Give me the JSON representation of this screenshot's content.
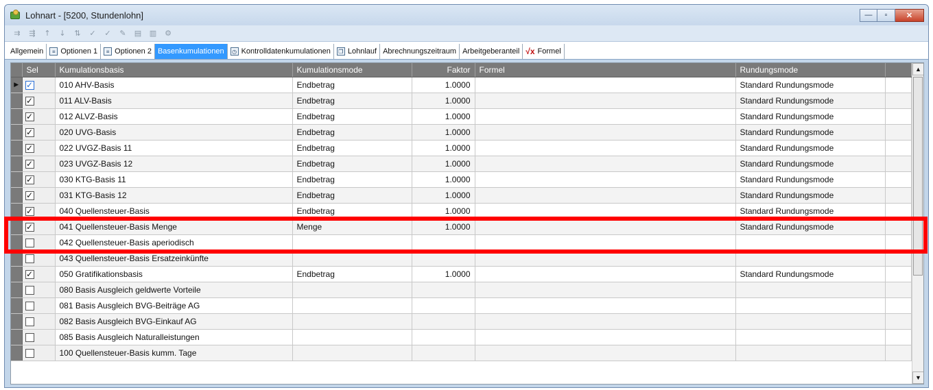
{
  "window": {
    "title": "Lohnart - [5200, Stundenlohn]",
    "buttons": {
      "minimize": "—",
      "maximize": "▫",
      "close": "✕"
    }
  },
  "toolbar": {
    "icons": [
      "insert-row-icon",
      "delete-row-icon",
      "move-up-icon",
      "move-down-icon",
      "sort-icon",
      "spell-check-icon",
      "spell-check-all-icon",
      "edit-icon",
      "report-icon",
      "report-list-icon",
      "properties-icon"
    ]
  },
  "tabs": [
    {
      "label": "Allgemein",
      "icon": ""
    },
    {
      "label": "Optionen 1",
      "icon": "page-icon"
    },
    {
      "label": "Optionen 2",
      "icon": "page-icon"
    },
    {
      "label": "Basenkumulationen",
      "icon": "",
      "active": true
    },
    {
      "label": "Kontrolldatenkumulationen",
      "icon": "clock-icon"
    },
    {
      "label": "Lohnlauf",
      "icon": "copy-icon"
    },
    {
      "label": "Abrechnungszeitraum",
      "icon": ""
    },
    {
      "label": "Arbeitgeberanteil",
      "icon": ""
    },
    {
      "label": "Formel",
      "icon": "formula-icon"
    }
  ],
  "grid": {
    "columns": {
      "sel": "Sel",
      "basis": "Kumulationsbasis",
      "mode": "Kumulationsmode",
      "faktor": "Faktor",
      "formel": "Formel",
      "rundung": "Rundungsmode"
    },
    "rows": [
      {
        "checked": true,
        "basis": "010 AHV-Basis",
        "mode": "Endbetrag",
        "faktor": "1.0000",
        "formel": "",
        "rundung": "Standard Rundungsmode",
        "current": true
      },
      {
        "checked": true,
        "basis": "011 ALV-Basis",
        "mode": "Endbetrag",
        "faktor": "1.0000",
        "formel": "",
        "rundung": "Standard Rundungsmode"
      },
      {
        "checked": true,
        "basis": "012 ALVZ-Basis",
        "mode": "Endbetrag",
        "faktor": "1.0000",
        "formel": "",
        "rundung": "Standard Rundungsmode"
      },
      {
        "checked": true,
        "basis": "020 UVG-Basis",
        "mode": "Endbetrag",
        "faktor": "1.0000",
        "formel": "",
        "rundung": "Standard Rundungsmode"
      },
      {
        "checked": true,
        "basis": "022 UVGZ-Basis 11",
        "mode": "Endbetrag",
        "faktor": "1.0000",
        "formel": "",
        "rundung": "Standard Rundungsmode"
      },
      {
        "checked": true,
        "basis": "023 UVGZ-Basis 12",
        "mode": "Endbetrag",
        "faktor": "1.0000",
        "formel": "",
        "rundung": "Standard Rundungsmode"
      },
      {
        "checked": true,
        "basis": "030 KTG-Basis 11",
        "mode": "Endbetrag",
        "faktor": "1.0000",
        "formel": "",
        "rundung": "Standard Rundungsmode"
      },
      {
        "checked": true,
        "basis": "031 KTG-Basis 12",
        "mode": "Endbetrag",
        "faktor": "1.0000",
        "formel": "",
        "rundung": "Standard Rundungsmode"
      },
      {
        "checked": true,
        "basis": "040 Quellensteuer-Basis",
        "mode": "Endbetrag",
        "faktor": "1.0000",
        "formel": "",
        "rundung": "Standard Rundungsmode"
      },
      {
        "checked": true,
        "basis": "041 Quellensteuer-Basis Menge",
        "mode": "Menge",
        "faktor": "1.0000",
        "formel": "",
        "rundung": "Standard Rundungsmode"
      },
      {
        "checked": false,
        "basis": "042 Quellensteuer-Basis aperiodisch",
        "mode": "",
        "faktor": "",
        "formel": "",
        "rundung": ""
      },
      {
        "checked": false,
        "basis": "043 Quellensteuer-Basis Ersatzeinkünfte",
        "mode": "",
        "faktor": "",
        "formel": "",
        "rundung": ""
      },
      {
        "checked": true,
        "basis": "050 Gratifikationsbasis",
        "mode": "Endbetrag",
        "faktor": "1.0000",
        "formel": "",
        "rundung": "Standard Rundungsmode"
      },
      {
        "checked": false,
        "basis": "080 Basis Ausgleich geldwerte Vorteile",
        "mode": "",
        "faktor": "",
        "formel": "",
        "rundung": ""
      },
      {
        "checked": false,
        "basis": "081 Basis Ausgleich BVG-Beiträge AG",
        "mode": "",
        "faktor": "",
        "formel": "",
        "rundung": ""
      },
      {
        "checked": false,
        "basis": "082 Basis Ausgleich BVG-Einkauf AG",
        "mode": "",
        "faktor": "",
        "formel": "",
        "rundung": ""
      },
      {
        "checked": false,
        "basis": "085 Basis Ausgleich Naturalleistungen",
        "mode": "",
        "faktor": "",
        "formel": "",
        "rundung": ""
      },
      {
        "checked": false,
        "basis": "100 Quellensteuer-Basis kumm. Tage",
        "mode": "",
        "faktor": "",
        "formel": "",
        "rundung": ""
      }
    ]
  },
  "highlight_color": "#ff0000",
  "accent_color": "#3399ff"
}
